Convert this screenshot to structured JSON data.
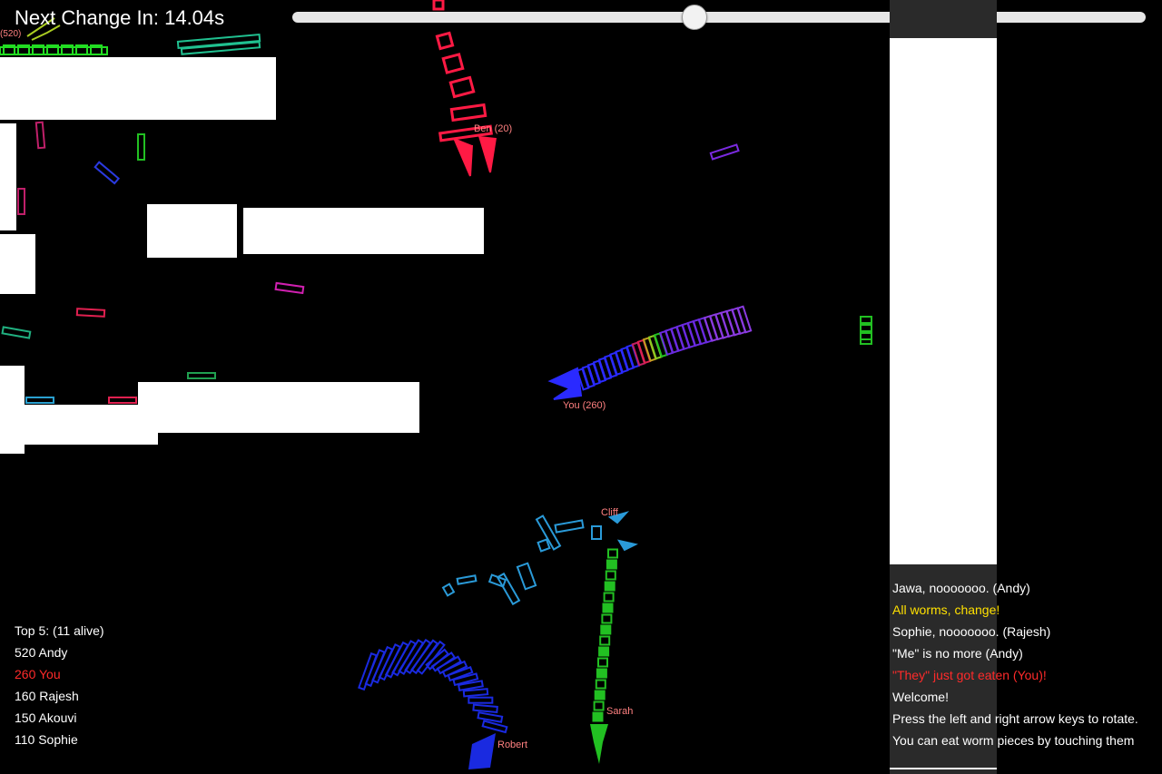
{
  "hud": {
    "timer_text": "Next Change In: 14.04s",
    "slider_value_percent": 47
  },
  "labels": {
    "andy_score_fragment": "(520)",
    "ben": "Ben (20)",
    "you": "You (260)",
    "cliff": "Cliff",
    "sarah": "Sarah",
    "robert": "Robert"
  },
  "leaderboard": {
    "title": "Top 5: (11 alive)",
    "rows": [
      {
        "text": "520 Andy",
        "color": "#ffffff"
      },
      {
        "text": "260 You",
        "color": "#ff2a2a"
      },
      {
        "text": "160 Rajesh",
        "color": "#ffffff"
      },
      {
        "text": "150 Akouvi",
        "color": "#ffffff"
      },
      {
        "text": "110 Sophie",
        "color": "#ffffff"
      }
    ]
  },
  "chat": {
    "messages": [
      {
        "text": "Jawa, nooooooo. (Andy)",
        "color": "#ffffff"
      },
      {
        "text": "All worms, change!",
        "color": "#ffe000"
      },
      {
        "text": "Sophie, nooooooo. (Rajesh)",
        "color": "#ffffff"
      },
      {
        "text": "\"Me\" is no more (Andy)",
        "color": "#ffffff"
      },
      {
        "text": "\"They\" just got eaten (You)!",
        "color": "#ff2a2a"
      },
      {
        "text": "Welcome!",
        "color": "#ffffff"
      },
      {
        "text": "Press the left and right arrow keys to rotate.",
        "color": "#ffffff"
      },
      {
        "text": "You can eat worm pieces by touching them",
        "color": "#ffffff"
      }
    ]
  },
  "colors": {
    "background": "#000000",
    "worm_you": "#2a2aff",
    "worm_ben": "#ff1a44",
    "worm_cliff": "#2a9ad8",
    "worm_sarah": "#22c022",
    "worm_robert": "#1a2ae0",
    "worm_andy": "#22dd22",
    "name_label": "#ff8080"
  }
}
